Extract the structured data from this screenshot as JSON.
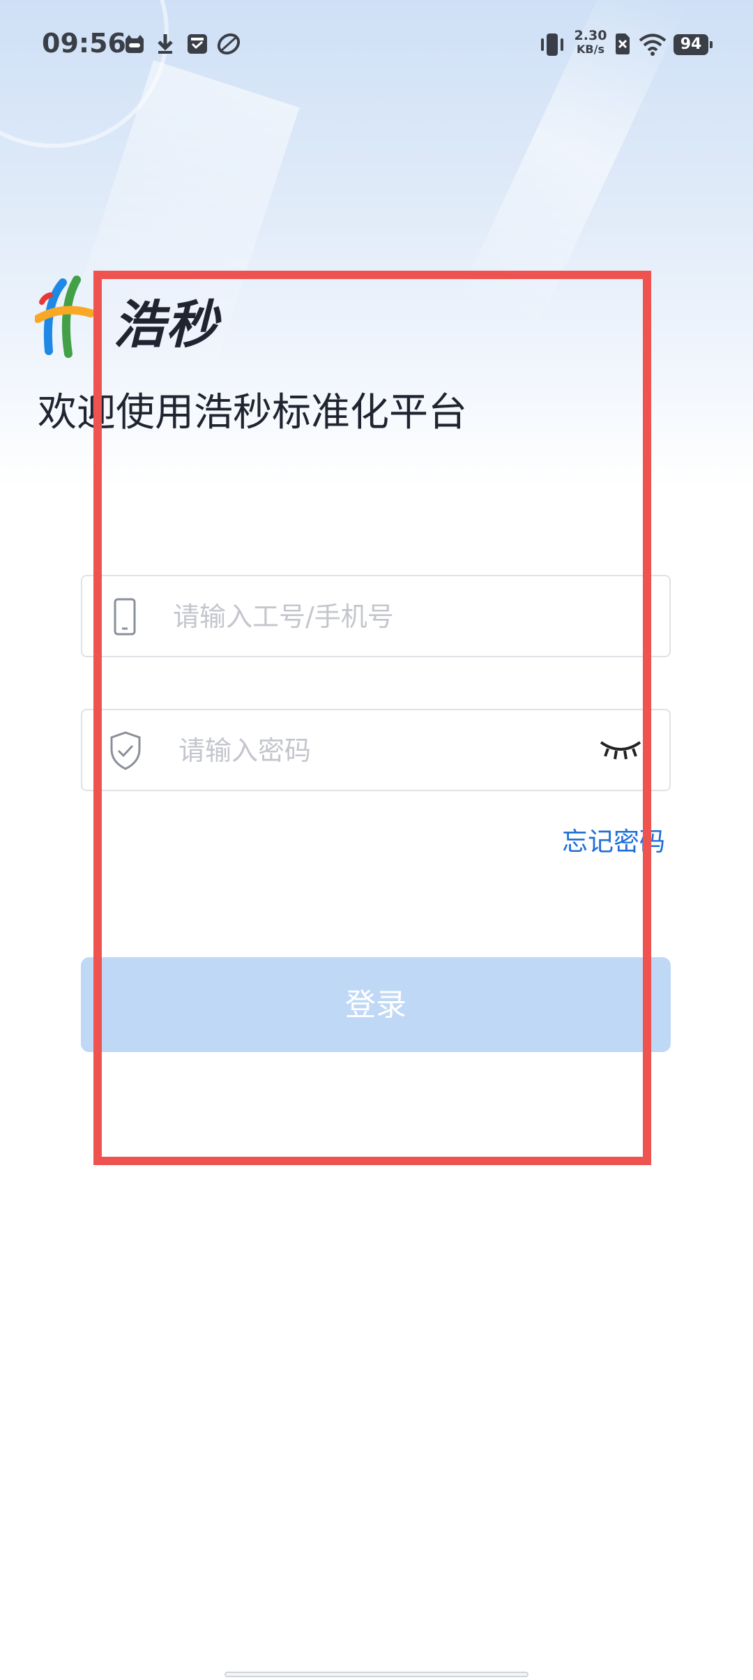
{
  "status_bar": {
    "time": "09:56",
    "net_speed_value": "2.30",
    "net_speed_unit": "KB/s",
    "battery": "94"
  },
  "brand": {
    "name": "浩秒",
    "welcome": "欢迎使用浩秒标准化平台",
    "logo_colors": [
      "#1e88e5",
      "#43a047",
      "#f9a825",
      "#e53935"
    ]
  },
  "login_form": {
    "account_placeholder": "请输入工号/手机号",
    "password_placeholder": "请输入密码",
    "forgot_password": "忘记密码",
    "login_button": "登录"
  },
  "colors": {
    "accent": "#1f6fd6",
    "button_disabled": "#bfd8f5",
    "highlight": "#ef5350"
  },
  "icons": {
    "account": "phone-icon",
    "password": "shield-check-icon",
    "visibility": "eye-closed-icon"
  }
}
